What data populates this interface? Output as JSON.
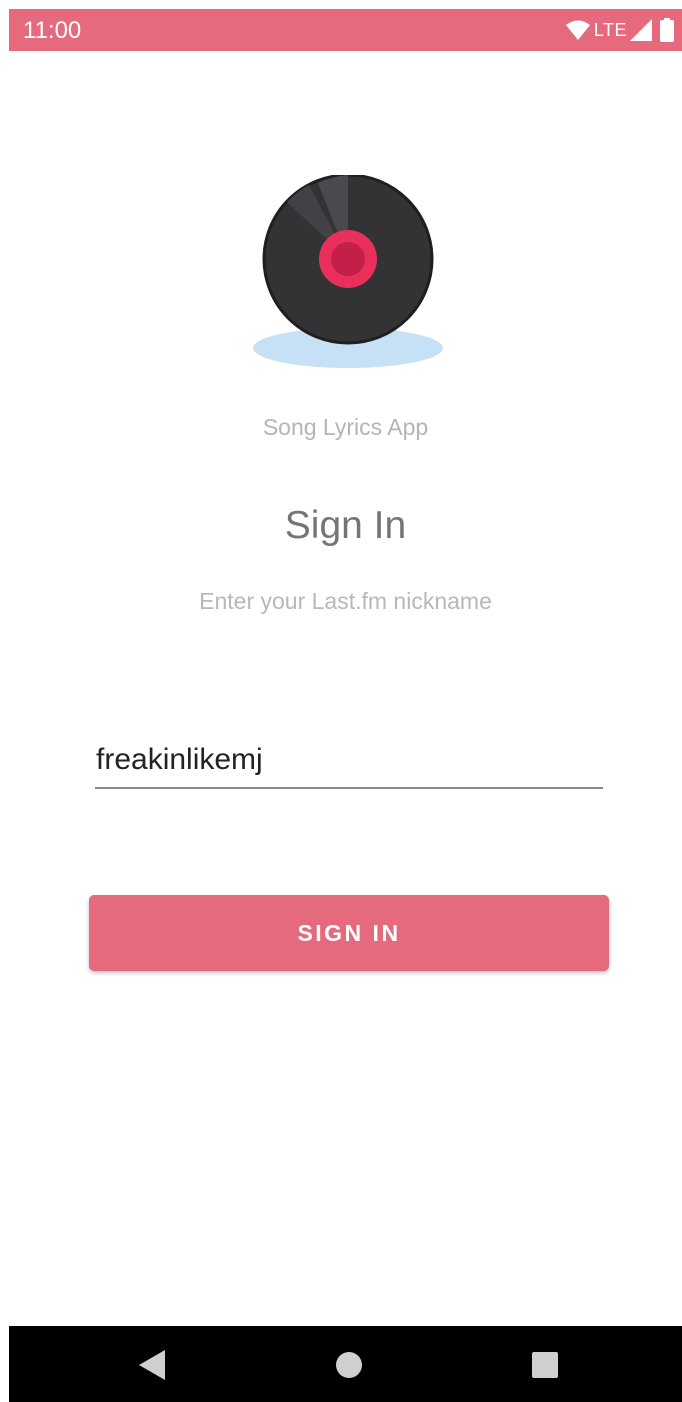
{
  "status_bar": {
    "time": "11:00",
    "network": "LTE",
    "background_color": "#e66a7e"
  },
  "logo": {
    "icon": "vinyl-record-icon",
    "colors": {
      "disc": "#333336",
      "label": "#e8305a",
      "label_center": "#c21f49",
      "shadow": "#c6e0f5"
    }
  },
  "app_name": "Song Lyrics App",
  "title": "Sign In",
  "subtitle": "Enter your Last.fm nickname",
  "nickname_input": {
    "value": "freakinlikemj"
  },
  "sign_in_button": {
    "label": "SIGN IN",
    "color": "#e66a7e"
  },
  "nav_bar": {
    "back_icon": "back-triangle-icon",
    "home_icon": "home-circle-icon",
    "recents_icon": "recents-square-icon"
  }
}
